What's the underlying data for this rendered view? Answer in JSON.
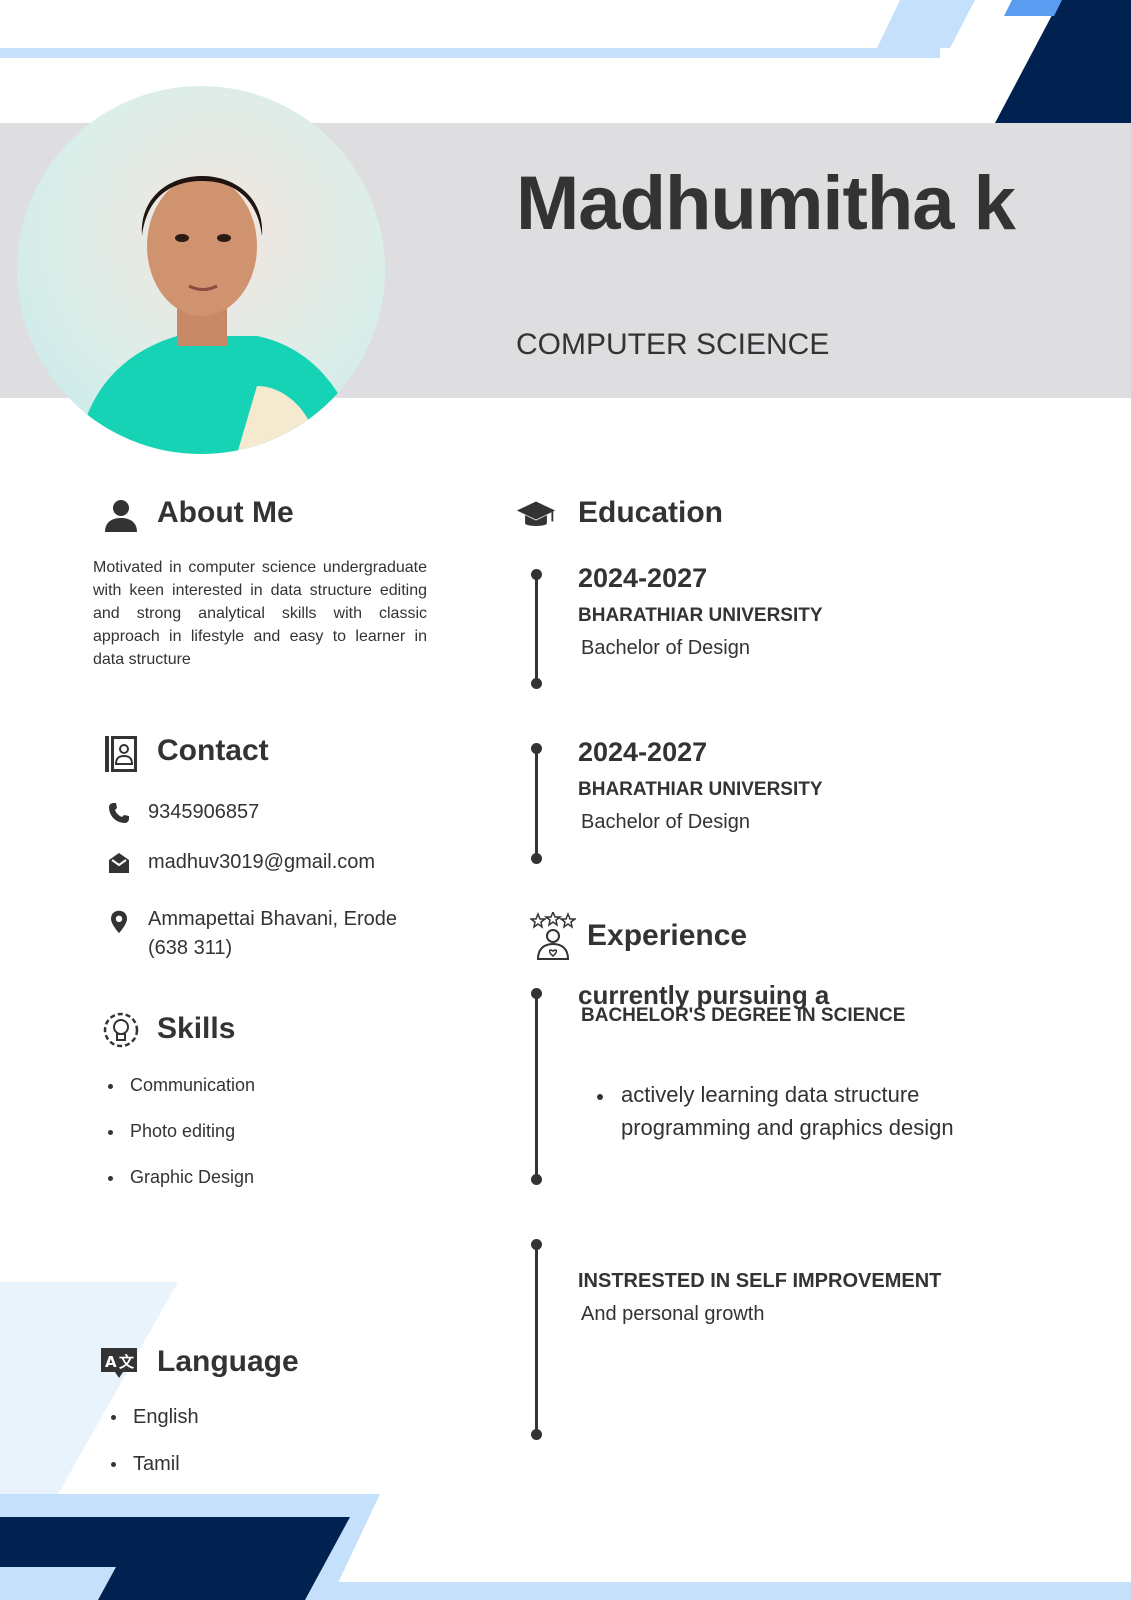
{
  "header": {
    "name": "Madhumitha k",
    "role": "COMPUTER SCIENCE"
  },
  "about": {
    "title": "About Me",
    "text": "Motivated in computer science undergraduate with keen interested in data structure editing and strong analytical skills with classic approach in lifestyle and easy to learner in data structure"
  },
  "contact": {
    "title": "Contact",
    "phone": "9345906857",
    "email": "madhuv3019@gmail.com",
    "address_line1": "Ammapettai Bhavani, Erode",
    "address_line2": "(638 311)"
  },
  "skills": {
    "title": "Skills",
    "items": [
      "Communication",
      "Photo editing",
      "Graphic Design"
    ]
  },
  "language": {
    "title": "Language",
    "items": [
      "English",
      "Tamil"
    ]
  },
  "education": {
    "title": "Education",
    "entries": [
      {
        "years": "2024-2027",
        "school": "BHARATHIAR UNIVERSITY",
        "degree": "Bachelor of Design"
      },
      {
        "years": "2024-2027",
        "school": "BHARATHIAR UNIVERSITY",
        "degree": "Bachelor of Design"
      }
    ]
  },
  "experience": {
    "title": "Experience",
    "entry1_heading": "currently pursuing a",
    "entry1_sub": "BACHELOR'S DEGREE IN SCIENCE",
    "entry1_bullet_line1": "actively learning data structure",
    "entry1_bullet_line2": "programming and graphics design",
    "entry2_heading": "INSTRESTED IN SELF IMPROVEMENT",
    "entry2_sub": "And personal growth"
  },
  "colors": {
    "navy": "#012250",
    "light_blue": "#c4e0fa",
    "pale_blue": "#e8f3fc",
    "accent_blue": "#5a9cf0",
    "band_gray": "#dedee0",
    "text": "#333333"
  }
}
